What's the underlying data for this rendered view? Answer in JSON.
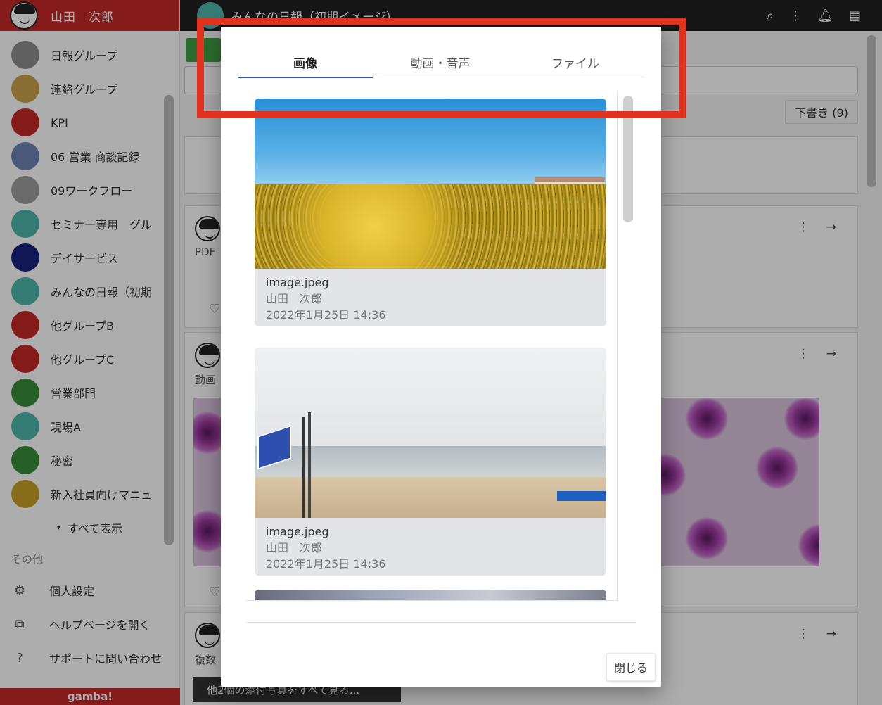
{
  "sidebar": {
    "user_name": "山田　次郎",
    "groups": [
      {
        "label": "日報グループ",
        "color": "#8e8e8e"
      },
      {
        "label": "連絡グループ",
        "color": "#c9a24a"
      },
      {
        "label": "KPI",
        "color": "#c62828"
      },
      {
        "label": "06 営業 商談記録",
        "color": "#6d84b4"
      },
      {
        "label": "09ワークフロー",
        "color": "#9e9e9e"
      },
      {
        "label": "セミナー専用　グル",
        "color": "#4db6ac"
      },
      {
        "label": "デイサービス",
        "color": "#1a237e"
      },
      {
        "label": "みんなの日報（初期",
        "color": "#4db6ac"
      },
      {
        "label": "他グループB",
        "color": "#c62828"
      },
      {
        "label": "他グループC",
        "color": "#c62828"
      },
      {
        "label": "営業部門",
        "color": "#388e3c"
      },
      {
        "label": "現場A",
        "color": "#4db6ac"
      },
      {
        "label": "秘密",
        "color": "#388e3c"
      },
      {
        "label": "新入社員向けマニュ",
        "color": "#c9a227"
      }
    ],
    "show_all": "すべて表示",
    "other_section": "その他",
    "menu": [
      {
        "label": "個人設定",
        "icon": "gear-icon",
        "glyph": "⚙"
      },
      {
        "label": "ヘルプページを開く",
        "icon": "external-link-icon",
        "glyph": "⧉"
      },
      {
        "label": "サポートに問い合わせ",
        "icon": "help-icon",
        "glyph": "?"
      }
    ],
    "footer_logo": "gamba!"
  },
  "topbar": {
    "title": "みんなの日報（初期イメージ）"
  },
  "content": {
    "drafts_label": "下書き (9)",
    "cards": [
      {
        "type_label": "PDF"
      },
      {
        "type_label": "動画"
      },
      {
        "type_label": "複数"
      }
    ],
    "more_photos": "他2個の添付写真をすべて見る..."
  },
  "dialog": {
    "tabs": [
      {
        "label": "画像",
        "active": true
      },
      {
        "label": "動画・音声",
        "active": false
      },
      {
        "label": "ファイル",
        "active": false
      }
    ],
    "items": [
      {
        "filename": "image.jpeg",
        "author": "山田　次郎",
        "date": "2022年1月25日 14:36"
      },
      {
        "filename": "image.jpeg",
        "author": "山田　次郎",
        "date": "2022年1月25日 14:36"
      }
    ],
    "close_label": "閉じる"
  },
  "colors": {
    "brand_red": "#c62828",
    "tab_indicator": "#3f51b5",
    "highlight": "#e0321c"
  }
}
